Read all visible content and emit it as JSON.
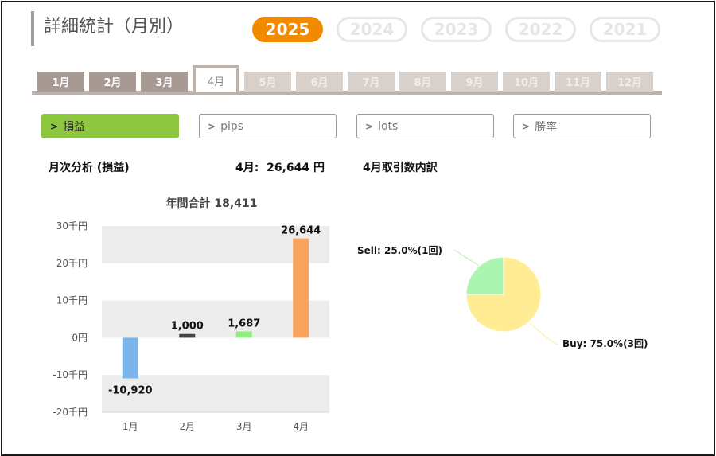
{
  "page_title": "詳細統計（月別）",
  "years": [
    "2025",
    "2024",
    "2023",
    "2022",
    "2021"
  ],
  "active_year": "2025",
  "months": [
    "1月",
    "2月",
    "3月",
    "4月",
    "5月",
    "6月",
    "7月",
    "8月",
    "9月",
    "10月",
    "11月",
    "12月"
  ],
  "active_month": "4月",
  "metrics": [
    {
      "chevron": ">",
      "label": "損益"
    },
    {
      "chevron": ">",
      "label": "pips"
    },
    {
      "chevron": ">",
      "label": "lots"
    },
    {
      "chevron": ">",
      "label": "勝率"
    }
  ],
  "active_metric": "損益",
  "summary": {
    "analysis_label": "月次分析 (損益)",
    "month_total": "4月:  26,644 円",
    "trades_breakdown_label": "4月取引数内訳"
  },
  "colors": {
    "accent": "#f28a00",
    "active_metric": "#8dc63f",
    "tab": "#bcb1ab"
  },
  "chart_data": [
    {
      "type": "bar",
      "title": "年間合計 18,411",
      "categories": [
        "1月",
        "2月",
        "3月",
        "4月"
      ],
      "values": [
        -10920,
        1000,
        1687,
        26644
      ],
      "data_labels": [
        "-10,920",
        "1,000",
        "1,687",
        "26,644"
      ],
      "bar_colors": [
        "#7cb5ec",
        "#434348",
        "#90ed7d",
        "#f7a35c"
      ],
      "ylim": [
        -20000,
        30000
      ],
      "yticks": [
        30000,
        20000,
        10000,
        0,
        -10000,
        -20000
      ],
      "ytick_labels": [
        "30千円",
        "20千円",
        "10千円",
        "0円",
        "-10千円",
        "-20千円"
      ],
      "grid": "alternating-bands",
      "legend": "none"
    },
    {
      "type": "pie",
      "labels": [
        "Sell",
        "Buy"
      ],
      "values": [
        1,
        3
      ],
      "data_labels": [
        "Sell: 25.0%(1回)",
        "Buy: 75.0%(3回)"
      ],
      "colors": [
        "#aaf5b0",
        "#ffec94"
      ],
      "legend": "none"
    }
  ]
}
